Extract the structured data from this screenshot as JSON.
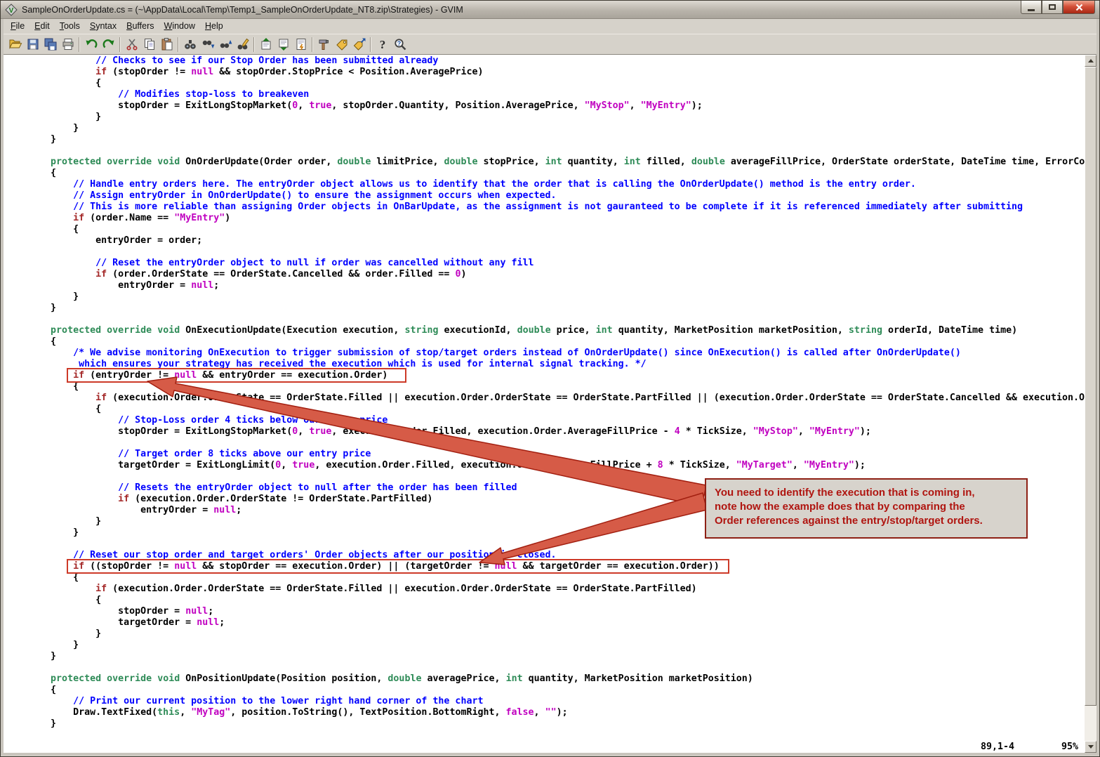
{
  "window": {
    "title": "SampleOnOrderUpdate.cs = (~\\AppData\\Local\\Temp\\Temp1_SampleOnOrderUpdate_NT8.zip\\Strategies) - GVIM"
  },
  "menubar": {
    "items": [
      {
        "label": "File"
      },
      {
        "label": "Edit"
      },
      {
        "label": "Tools"
      },
      {
        "label": "Syntax"
      },
      {
        "label": "Buffers"
      },
      {
        "label": "Window"
      },
      {
        "label": "Help"
      }
    ]
  },
  "toolbar": {
    "items": [
      {
        "name": "open-file-icon",
        "label": "Open"
      },
      {
        "name": "save-file-icon",
        "label": "Save"
      },
      {
        "name": "save-all-icon",
        "label": "Save All"
      },
      {
        "name": "print-icon",
        "label": "Print"
      },
      {
        "separator": true
      },
      {
        "name": "undo-icon",
        "label": "Undo"
      },
      {
        "name": "redo-icon",
        "label": "Redo"
      },
      {
        "separator": true
      },
      {
        "name": "cut-icon",
        "label": "Cut"
      },
      {
        "name": "copy-icon",
        "label": "Copy"
      },
      {
        "name": "paste-icon",
        "label": "Paste"
      },
      {
        "separator": true
      },
      {
        "name": "find-icon",
        "label": "Find"
      },
      {
        "name": "find-next-icon",
        "label": "Find Next"
      },
      {
        "name": "find-prev-icon",
        "label": "Find Previous"
      },
      {
        "name": "replace-icon",
        "label": "Find / Replace"
      },
      {
        "separator": true
      },
      {
        "name": "load-session-icon",
        "label": "Load Session"
      },
      {
        "name": "save-session-icon",
        "label": "Save Session"
      },
      {
        "name": "run-script-icon",
        "label": "Run Script"
      },
      {
        "separator": true
      },
      {
        "name": "make-icon",
        "label": "Make"
      },
      {
        "name": "run-ctags-icon",
        "label": "Build Tags"
      },
      {
        "name": "tag-jump-icon",
        "label": "Tag Jump"
      },
      {
        "separator": true
      },
      {
        "name": "help-icon",
        "label": "Help"
      },
      {
        "name": "find-help-icon",
        "label": "Find Help"
      }
    ]
  },
  "code": {
    "lines": [
      [
        [
          "c",
          "                // Checks to see if our Stop Order has been submitted already"
        ]
      ],
      [
        [
          "p",
          "                "
        ],
        [
          "k",
          "if"
        ],
        [
          "p",
          " (stopOrder != "
        ],
        [
          "n",
          "null"
        ],
        [
          "p",
          " && stopOrder.StopPrice < Position.AveragePrice)"
        ]
      ],
      [
        [
          "p",
          "                {"
        ]
      ],
      [
        [
          "c",
          "                    // Modifies stop-loss to breakeven"
        ]
      ],
      [
        [
          "p",
          "                    stopOrder = ExitLongStopMarket("
        ],
        [
          "n",
          "0"
        ],
        [
          "p",
          ", "
        ],
        [
          "n",
          "true"
        ],
        [
          "p",
          ", stopOrder.Quantity, Position.AveragePrice, "
        ],
        [
          "n",
          "\"MyStop\""
        ],
        [
          "p",
          ", "
        ],
        [
          "n",
          "\"MyEntry\""
        ],
        [
          "p",
          ");"
        ]
      ],
      [
        [
          "p",
          "                }"
        ]
      ],
      [
        [
          "p",
          "            }"
        ]
      ],
      [
        [
          "p",
          "        }"
        ]
      ],
      [],
      [
        [
          "p",
          "        "
        ],
        [
          "t",
          "protected"
        ],
        [
          "p",
          " "
        ],
        [
          "t",
          "override"
        ],
        [
          "p",
          " "
        ],
        [
          "t",
          "void"
        ],
        [
          "p",
          " OnOrderUpdate(Order order, "
        ],
        [
          "t",
          "double"
        ],
        [
          "p",
          " limitPrice, "
        ],
        [
          "t",
          "double"
        ],
        [
          "p",
          " stopPrice, "
        ],
        [
          "t",
          "int"
        ],
        [
          "p",
          " quantity, "
        ],
        [
          "t",
          "int"
        ],
        [
          "p",
          " filled, "
        ],
        [
          "t",
          "double"
        ],
        [
          "p",
          " averageFillPrice, OrderState orderState, DateTime time, ErrorCo"
        ]
      ],
      [
        [
          "p",
          "        {"
        ]
      ],
      [
        [
          "c",
          "            // Handle entry orders here. The entryOrder object allows us to identify that the order that is calling the OnOrderUpdate() method is the entry order."
        ]
      ],
      [
        [
          "c",
          "            // Assign entryOrder in OnOrderUpdate() to ensure the assignment occurs when expected."
        ]
      ],
      [
        [
          "c",
          "            // This is more reliable than assigning Order objects in OnBarUpdate, as the assignment is not gauranteed to be complete if it is referenced immediately after submitting"
        ]
      ],
      [
        [
          "p",
          "            "
        ],
        [
          "k",
          "if"
        ],
        [
          "p",
          " (order.Name == "
        ],
        [
          "n",
          "\"MyEntry\""
        ],
        [
          "p",
          ")"
        ]
      ],
      [
        [
          "p",
          "            {"
        ]
      ],
      [
        [
          "p",
          "                entryOrder = order;"
        ]
      ],
      [],
      [
        [
          "c",
          "                // Reset the entryOrder object to null if order was cancelled without any fill"
        ]
      ],
      [
        [
          "p",
          "                "
        ],
        [
          "k",
          "if"
        ],
        [
          "p",
          " (order.OrderState == OrderState.Cancelled && order.Filled == "
        ],
        [
          "n",
          "0"
        ],
        [
          "p",
          ")"
        ]
      ],
      [
        [
          "p",
          "                    entryOrder = "
        ],
        [
          "n",
          "null"
        ],
        [
          "p",
          ";"
        ]
      ],
      [
        [
          "p",
          "            }"
        ]
      ],
      [
        [
          "p",
          "        }"
        ]
      ],
      [],
      [
        [
          "p",
          "        "
        ],
        [
          "t",
          "protected"
        ],
        [
          "p",
          " "
        ],
        [
          "t",
          "override"
        ],
        [
          "p",
          " "
        ],
        [
          "t",
          "void"
        ],
        [
          "p",
          " OnExecutionUpdate(Execution execution, "
        ],
        [
          "t",
          "string"
        ],
        [
          "p",
          " executionId, "
        ],
        [
          "t",
          "double"
        ],
        [
          "p",
          " price, "
        ],
        [
          "t",
          "int"
        ],
        [
          "p",
          " quantity, MarketPosition marketPosition, "
        ],
        [
          "t",
          "string"
        ],
        [
          "p",
          " orderId, DateTime time)"
        ]
      ],
      [
        [
          "p",
          "        {"
        ]
      ],
      [
        [
          "c",
          "            /* We advise monitoring OnExecution to trigger submission of stop/target orders instead of OnOrderUpdate() since OnExecution() is called after OnOrderUpdate()"
        ]
      ],
      [
        [
          "c",
          "             which ensures your strategy has received the execution which is used for internal signal tracking. */"
        ]
      ],
      [
        [
          "p",
          "            "
        ],
        [
          "k",
          "if"
        ],
        [
          "p",
          " (entryOrder != "
        ],
        [
          "n",
          "null"
        ],
        [
          "p",
          " && entryOrder == execution.Order)"
        ]
      ],
      [
        [
          "p",
          "            {"
        ]
      ],
      [
        [
          "p",
          "                "
        ],
        [
          "k",
          "if"
        ],
        [
          "p",
          " (execution.Order.OrderState == OrderState.Filled || execution.Order.OrderState == OrderState.PartFilled || (execution.Order.OrderState == OrderState.Cancelled && execution.O"
        ]
      ],
      [
        [
          "p",
          "                {"
        ]
      ],
      [
        [
          "c",
          "                    // Stop-Loss order 4 ticks below our entry price"
        ]
      ],
      [
        [
          "p",
          "                    stopOrder = ExitLongStopMarket("
        ],
        [
          "n",
          "0"
        ],
        [
          "p",
          ", "
        ],
        [
          "n",
          "true"
        ],
        [
          "p",
          ", execution.Order.Filled, execution.Order.AverageFillPrice - "
        ],
        [
          "n",
          "4"
        ],
        [
          "p",
          " * TickSize, "
        ],
        [
          "n",
          "\"MyStop\""
        ],
        [
          "p",
          ", "
        ],
        [
          "n",
          "\"MyEntry\""
        ],
        [
          "p",
          ");"
        ]
      ],
      [],
      [
        [
          "c",
          "                    // Target order 8 ticks above our entry price"
        ]
      ],
      [
        [
          "p",
          "                    targetOrder = ExitLongLimit("
        ],
        [
          "n",
          "0"
        ],
        [
          "p",
          ", "
        ],
        [
          "n",
          "true"
        ],
        [
          "p",
          ", execution.Order.Filled, execution.Order.AverageFillPrice + "
        ],
        [
          "n",
          "8"
        ],
        [
          "p",
          " * TickSize, "
        ],
        [
          "n",
          "\"MyTarget\""
        ],
        [
          "p",
          ", "
        ],
        [
          "n",
          "\"MyEntry\""
        ],
        [
          "p",
          ");"
        ]
      ],
      [],
      [
        [
          "c",
          "                    // Resets the entryOrder object to null after the order has been filled"
        ]
      ],
      [
        [
          "p",
          "                    "
        ],
        [
          "k",
          "if"
        ],
        [
          "p",
          " (execution.Order.OrderState != OrderState.PartFilled)"
        ]
      ],
      [
        [
          "p",
          "                        entryOrder = "
        ],
        [
          "n",
          "null"
        ],
        [
          "p",
          ";"
        ]
      ],
      [
        [
          "p",
          "                }"
        ]
      ],
      [
        [
          "p",
          "            }"
        ]
      ],
      [],
      [
        [
          "c",
          "            // Reset our stop order and target orders' Order objects after our position is closed."
        ]
      ],
      [
        [
          "p",
          "            "
        ],
        [
          "k",
          "if"
        ],
        [
          "p",
          " ((stopOrder != "
        ],
        [
          "n",
          "null"
        ],
        [
          "p",
          " && stopOrder == execution.Order) || (targetOrder != "
        ],
        [
          "n",
          "null"
        ],
        [
          "p",
          " && targetOrder == execution.Order))"
        ]
      ],
      [
        [
          "p",
          "            {"
        ]
      ],
      [
        [
          "p",
          "                "
        ],
        [
          "k",
          "if"
        ],
        [
          "p",
          " (execution.Order.OrderState == OrderState.Filled || execution.Order.OrderState == OrderState.PartFilled)"
        ]
      ],
      [
        [
          "p",
          "                {"
        ]
      ],
      [
        [
          "p",
          "                    stopOrder = "
        ],
        [
          "n",
          "null"
        ],
        [
          "p",
          ";"
        ]
      ],
      [
        [
          "p",
          "                    targetOrder = "
        ],
        [
          "n",
          "null"
        ],
        [
          "p",
          ";"
        ]
      ],
      [
        [
          "p",
          "                }"
        ]
      ],
      [
        [
          "p",
          "            }"
        ]
      ],
      [
        [
          "p",
          "        }"
        ]
      ],
      [],
      [
        [
          "p",
          "        "
        ],
        [
          "t",
          "protected"
        ],
        [
          "p",
          " "
        ],
        [
          "t",
          "override"
        ],
        [
          "p",
          " "
        ],
        [
          "t",
          "void"
        ],
        [
          "p",
          " OnPositionUpdate(Position position, "
        ],
        [
          "t",
          "double"
        ],
        [
          "p",
          " averagePrice, "
        ],
        [
          "t",
          "int"
        ],
        [
          "p",
          " quantity, MarketPosition marketPosition)"
        ]
      ],
      [
        [
          "p",
          "        {"
        ]
      ],
      [
        [
          "c",
          "            // Print our current position to the lower right hand corner of the chart"
        ]
      ],
      [
        [
          "p",
          "            Draw.TextFixed("
        ],
        [
          "t",
          "this"
        ],
        [
          "p",
          ", "
        ],
        [
          "n",
          "\"MyTag\""
        ],
        [
          "p",
          ", position.ToString(), TextPosition.BottomRight, "
        ],
        [
          "n",
          "false"
        ],
        [
          "p",
          ", "
        ],
        [
          "n",
          "\"\""
        ],
        [
          "p",
          ");"
        ]
      ],
      [
        [
          "p",
          "        }"
        ]
      ]
    ]
  },
  "annotations": {
    "highlight_boxes": [
      {
        "label": "entry-order-comparison"
      },
      {
        "label": "stop-target-order-comparison"
      }
    ],
    "callout": {
      "lines": [
        "You need to identify the execution that is coming in,",
        "note how the example does that by comparing the",
        "Order references against the entry/stop/target orders."
      ]
    }
  },
  "status": {
    "ruler": "89,1-4",
    "scroll_percent": "95%"
  },
  "colors": {
    "comment": "#0000ff",
    "keyword": "#a52a2a",
    "type": "#2e8b57",
    "constant": "#c000c0",
    "plain": "#000000",
    "annotation_box": "#cd3a28",
    "annotation_arrow_fill": "#d65b47",
    "annotation_arrow_stroke": "#a21f10",
    "callout_bg": "#d7d3cc",
    "callout_border": "#8e2015",
    "callout_text": "#b01510"
  }
}
